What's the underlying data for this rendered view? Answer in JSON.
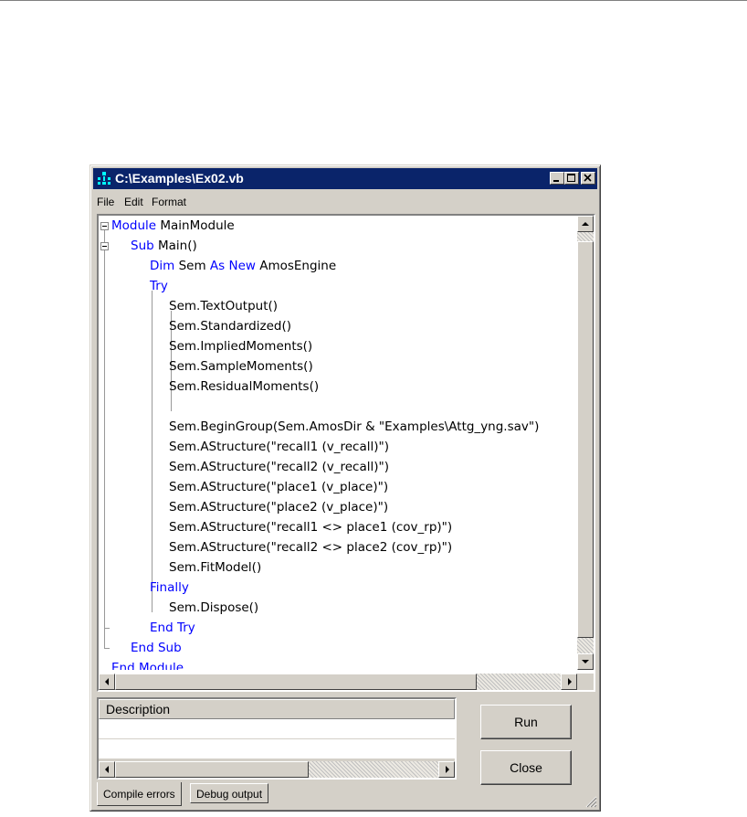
{
  "window": {
    "title": "C:\\Examples\\Ex02.vb",
    "minimize_icon": "minimize-icon",
    "maximize_icon": "maximize-icon",
    "close_icon": "close-icon"
  },
  "menu": {
    "file": "File",
    "edit": "Edit",
    "format": "Format"
  },
  "code": {
    "lines": [
      {
        "kw": "Module",
        "rest": " MainModule"
      },
      {
        "kw": "Sub",
        "rest": " Main()"
      },
      {
        "kw": "Dim",
        "rest": " Sem ",
        "kw2": "As New",
        "rest2": " AmosEngine"
      },
      {
        "kw": "Try",
        "rest": ""
      },
      {
        "kw": "",
        "rest": "Sem.TextOutput()"
      },
      {
        "kw": "",
        "rest": "Sem.Standardized()"
      },
      {
        "kw": "",
        "rest": "Sem.ImpliedMoments()"
      },
      {
        "kw": "",
        "rest": "Sem.SampleMoments()"
      },
      {
        "kw": "",
        "rest": "Sem.ResidualMoments()"
      },
      {
        "kw": "",
        "rest": ""
      },
      {
        "kw": "",
        "rest": "Sem.BeginGroup(Sem.AmosDir & \"Examples\\Attg_yng.sav\")"
      },
      {
        "kw": "",
        "rest": "Sem.AStructure(\"recall1 (v_recall)\")"
      },
      {
        "kw": "",
        "rest": "Sem.AStructure(\"recall2 (v_recall)\")"
      },
      {
        "kw": "",
        "rest": "Sem.AStructure(\"place1 (v_place)\")"
      },
      {
        "kw": "",
        "rest": "Sem.AStructure(\"place2 (v_place)\")"
      },
      {
        "kw": "",
        "rest": "Sem.AStructure(\"recall1 <> place1 (cov_rp)\")"
      },
      {
        "kw": "",
        "rest": "Sem.AStructure(\"recall2 <> place2 (cov_rp)\")"
      },
      {
        "kw": "",
        "rest": "Sem.FitModel()"
      },
      {
        "kw": "Finally",
        "rest": ""
      },
      {
        "kw": "",
        "rest": "Sem.Dispose()"
      },
      {
        "kw": "End Try",
        "rest": ""
      },
      {
        "kw": "End Sub",
        "rest": ""
      },
      {
        "kw": "End Module",
        "rest": ""
      }
    ]
  },
  "errors": {
    "header": "Description"
  },
  "tabs": {
    "compile": "Compile errors",
    "debug": "Debug output"
  },
  "buttons": {
    "run": "Run",
    "close": "Close"
  },
  "colors": {
    "keyword": "#0000ff",
    "titlebar": "#0a246a",
    "face": "#d4d0c8"
  }
}
